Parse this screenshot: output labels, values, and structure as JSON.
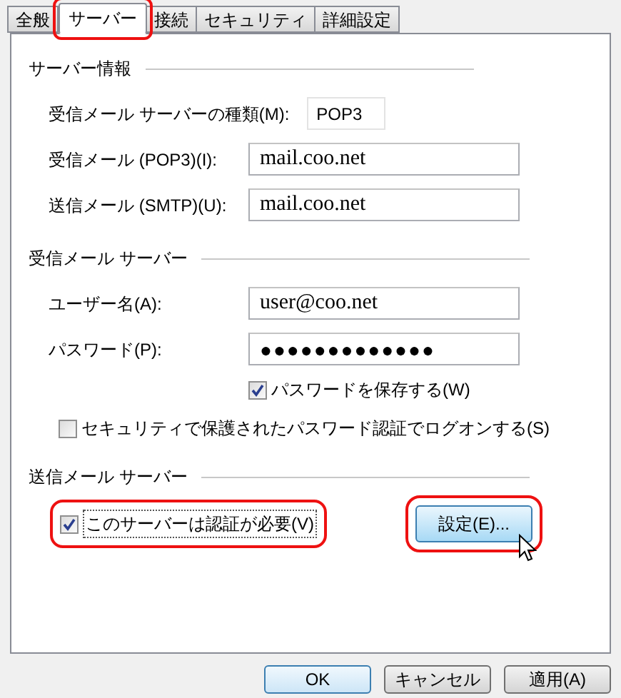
{
  "tabs": [
    {
      "label": "全般",
      "selected": false,
      "highlighted": false
    },
    {
      "label": "サーバー",
      "selected": true,
      "highlighted": true
    },
    {
      "label": "接続",
      "selected": false,
      "highlighted": false
    },
    {
      "label": "セキュリティ",
      "selected": false,
      "highlighted": false
    },
    {
      "label": "詳細設定",
      "selected": false,
      "highlighted": false
    }
  ],
  "sections": [
    {
      "title": "サーバー情報",
      "items": [
        {
          "kind": "short_field",
          "label": "受信メール サーバーの種類(M):",
          "value": "POP3"
        },
        {
          "kind": "field",
          "label": "受信メール (POP3)(I):",
          "value": "mail.coo.net"
        },
        {
          "kind": "field",
          "label": "送信メール (SMTP)(U):",
          "value": "mail.coo.net"
        }
      ]
    },
    {
      "title": "受信メール サーバー",
      "items": [
        {
          "kind": "field",
          "label": "ユーザー名(A):",
          "value": "user@coo.net"
        },
        {
          "kind": "password",
          "label": "パスワード(P):",
          "value": "●●●●●●●●●●●●●"
        },
        {
          "kind": "sub_checkbox",
          "label": "パスワードを保存する(W)",
          "checked": true
        },
        {
          "kind": "checkbox",
          "label": "セキュリティで保護されたパスワード認証でログオンする(S)",
          "checked": false
        }
      ]
    },
    {
      "title": "送信メール サーバー",
      "items": [
        {
          "kind": "checkbox_with_button",
          "checkbox": {
            "label": "このサーバーは認証が必要(V)",
            "checked": true,
            "highlighted": true
          },
          "button": {
            "label": "設定(E)...",
            "highlighted": true,
            "hovered": true
          }
        }
      ]
    }
  ],
  "footer_buttons": [
    {
      "label": "OK",
      "default": true
    },
    {
      "label": "キャンセル",
      "default": false
    },
    {
      "label": "適用(A)",
      "default": false
    }
  ]
}
